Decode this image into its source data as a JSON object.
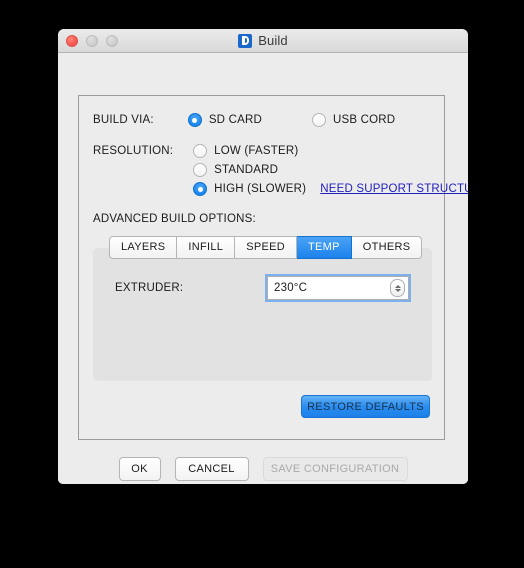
{
  "window": {
    "title": "Build",
    "app_icon": "build-app-icon",
    "traffic_lights": {
      "close": "close-button",
      "minimize": "minimize-button",
      "maximize": "maximize-button"
    }
  },
  "build_via": {
    "label": "BUILD VIA:",
    "options": [
      {
        "label": "SD CARD",
        "selected": true
      },
      {
        "label": "USB CORD",
        "selected": false
      }
    ]
  },
  "resolution": {
    "label": "RESOLUTION:",
    "options": [
      {
        "label": "LOW (FASTER)",
        "selected": false
      },
      {
        "label": "STANDARD",
        "selected": false
      },
      {
        "label": "HIGH (SLOWER)",
        "selected": true
      }
    ],
    "support_link": "NEED SUPPORT STRUCTURES?"
  },
  "advanced": {
    "label": "ADVANCED BUILD OPTIONS:",
    "tabs": [
      {
        "label": "LAYERS",
        "active": false
      },
      {
        "label": "INFILL",
        "active": false
      },
      {
        "label": "SPEED",
        "active": false
      },
      {
        "label": "TEMP",
        "active": true
      },
      {
        "label": "OTHERS",
        "active": false
      }
    ],
    "panel": {
      "extruder_label": "EXTRUDER:",
      "extruder_value": "230°C",
      "extruder_placeholder": "230°C",
      "stepper_up": "stepper-up-icon",
      "stepper_down": "stepper-down-icon"
    }
  },
  "buttons": {
    "restore_defaults": "RESTORE DEFAULTS",
    "ok": "OK",
    "cancel": "CANCEL",
    "save_configuration": "SAVE CONFIGURATION"
  },
  "colors": {
    "accent_blue": "#1e8bf0",
    "link_blue": "#2020c0",
    "window_bg": "#ececec",
    "panel_bg": "#e2e2e2",
    "desktop_bg": "#000000"
  }
}
